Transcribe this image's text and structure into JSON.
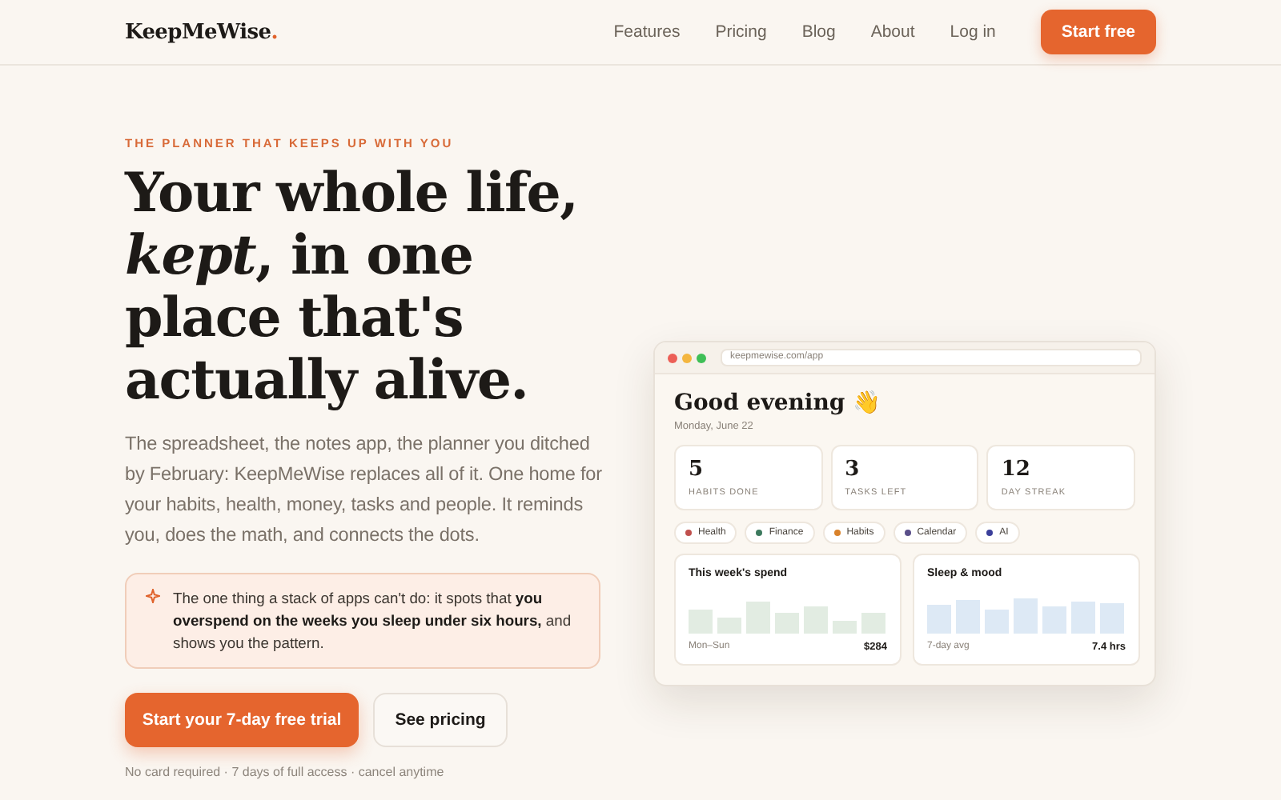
{
  "nav": {
    "logo": "KeepMeWise",
    "logo_dot": ".",
    "links": [
      "Features",
      "Pricing",
      "Blog",
      "About",
      "Log in"
    ],
    "cta": "Start free"
  },
  "hero": {
    "eyebrow": "THE PLANNER THAT KEEPS UP WITH YOU",
    "headline": "Your whole life, *kept*, in one place that's actually alive.",
    "body": "The spreadsheet, the notes app, the planner you ditched by February: KeepMeWise replaces all of it. One home for your habits, health, money, tasks and people. It reminds you, does the math, and connects the dots.",
    "callout": "The one thing a stack of apps can't do: it spots that **you overspend on the weeks you sleep under six hours,** and shows you the pattern.",
    "primary_button": "Start your 7-day free trial",
    "secondary_button": "See pricing",
    "footnote": "No card required · 7 days of full access · cancel anytime"
  },
  "app_preview": {
    "url": "keepmewise.com/app",
    "greeting": "Good evening 👋",
    "date": "Monday, June 22",
    "stats": [
      {
        "value": "5",
        "label": "HABITS DONE"
      },
      {
        "value": "3",
        "label": "TASKS LEFT"
      },
      {
        "value": "12",
        "label": "DAY STREAK"
      }
    ],
    "chips": [
      {
        "label": "Health",
        "color": "#c0504d"
      },
      {
        "label": "Finance",
        "color": "#3d7a5e"
      },
      {
        "label": "Habits",
        "color": "#d9822b"
      },
      {
        "label": "Calendar",
        "color": "#5a4f8a"
      },
      {
        "label": "AI",
        "color": "#3b3f9a"
      }
    ],
    "cards": [
      {
        "title": "This week's spend",
        "caption": "Mon–Sun",
        "total": "$284",
        "kind": "spend"
      },
      {
        "title": "Sleep & mood",
        "caption": "7-day avg",
        "total": "7.4 hrs",
        "kind": "sleep"
      }
    ]
  }
}
